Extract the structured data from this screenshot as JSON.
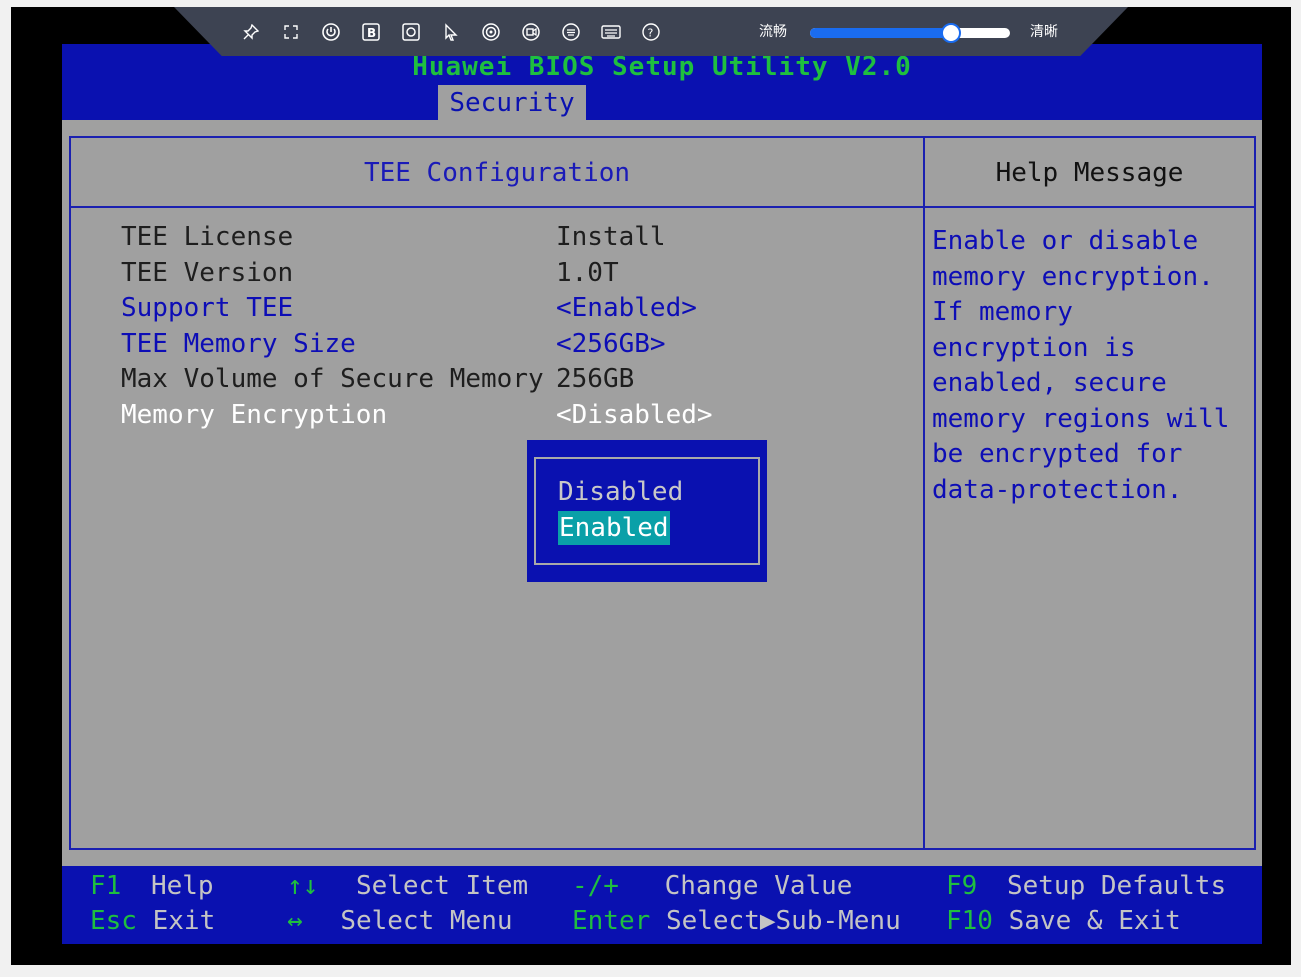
{
  "bios": {
    "title": "Huawei BIOS Setup Utility V2.0",
    "tab": "Security",
    "left_panel_title": "TEE Configuration",
    "right_panel_title": "Help Message",
    "settings": [
      {
        "label": "TEE License",
        "value": "Install",
        "style": "gray"
      },
      {
        "label": "TEE Version",
        "value": "1.0T",
        "style": "gray"
      },
      {
        "label": "Support TEE",
        "value": "<Enabled>",
        "style": "blue"
      },
      {
        "label": "TEE Memory Size",
        "value": "<256GB>",
        "style": "blue"
      },
      {
        "label": "Max Volume of Secure Memory",
        "value": "256GB",
        "style": "gray"
      },
      {
        "label": "Memory Encryption",
        "value": "<Disabled>",
        "style": "white"
      }
    ],
    "help_text": "Enable or disable\nmemory encryption.\nIf memory\nencryption is\nenabled, secure\nmemory regions will\nbe encrypted for\ndata-protection.",
    "popup_options": [
      "Disabled",
      "Enabled"
    ],
    "popup_selected": "Enabled",
    "footer": [
      {
        "key": "F1",
        "desc": "Help"
      },
      {
        "key": "Esc",
        "desc": "Exit"
      },
      {
        "key": "↑↓",
        "desc": "Select Item"
      },
      {
        "key": "↔",
        "desc": "Select Menu"
      },
      {
        "key": "-/+",
        "desc": "Change Value"
      },
      {
        "key": "Enter",
        "desc": "Select▶Sub-Menu"
      },
      {
        "key": "F9",
        "desc": "Setup Defaults"
      },
      {
        "key": "F10",
        "desc": "Save & Exit"
      }
    ]
  },
  "toolbar": {
    "icons": [
      "pin-icon",
      "fullscreen-icon",
      "power-icon",
      "b-icon",
      "screenshot-icon",
      "mouse-icon",
      "cd-icon",
      "record-icon",
      "keyboard-virtual-icon",
      "keyboard-icon",
      "help-icon"
    ],
    "quality_low_label": "流畅",
    "quality_high_label": "清晰",
    "quality_level": 0.7,
    "accent_color": "#1a6cf0"
  },
  "colors": {
    "bios_blue": "#0a11b0",
    "bios_gray": "#a0a0a0",
    "key_green": "#1fbf3f",
    "highlight_cyan": "#0aa0a8"
  }
}
